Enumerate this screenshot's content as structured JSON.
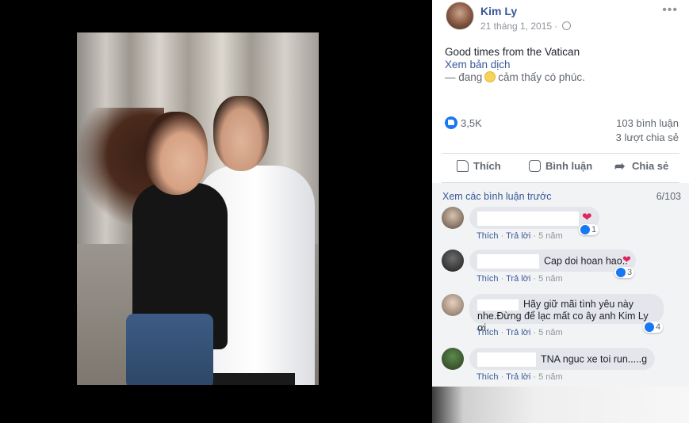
{
  "post": {
    "author": "Kim Ly",
    "time": "21 tháng 1, 2015",
    "more_icon": "more-icon",
    "text": "Good times from the Vatican",
    "translate": "Xem bản dịch",
    "feeling_prefix": "— đang",
    "feeling_text": "cảm thấy có phúc."
  },
  "stats": {
    "likes": "3,5K",
    "comments": "103 bình luận",
    "shares": "3 lượt chia sẻ"
  },
  "actions": {
    "like": "Thích",
    "comment": "Bình luận",
    "share": "Chia sẻ"
  },
  "comments_section": {
    "previous": "Xem các bình luận trước",
    "pager": "6/103",
    "meta_like": "Thích",
    "meta_reply": "Trả lời",
    "items": [
      {
        "text": "",
        "time": "5 năm",
        "reactions": "1"
      },
      {
        "text": "Cap doi hoan hao..",
        "time": "5 năm",
        "reactions": "3"
      },
      {
        "text_line1": "Hãy giữ mãi tình yêu này",
        "text_line2": "nhe.Đừng để lạc mất co ây anh Kim Ly ơi.",
        "time": "5 năm",
        "reactions": "4"
      },
      {
        "text": "TNA nguc xe toi run.....g",
        "time": "5 năm"
      }
    ]
  },
  "colors": {
    "link": "#385898",
    "like_blue": "#1877f2",
    "heart": "#e0245e"
  }
}
